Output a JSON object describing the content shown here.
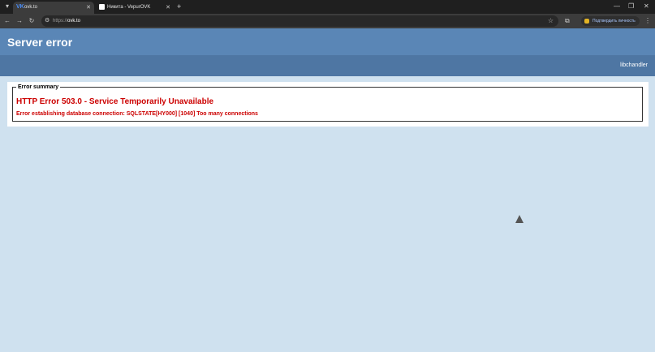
{
  "browser": {
    "tabs": [
      {
        "title": "ovk.to",
        "active": true,
        "icon": "vk-favicon"
      },
      {
        "title": "Никита - VepurOVK",
        "active": false,
        "icon": "page-favicon"
      }
    ],
    "new_tab_label": "+",
    "url_scheme": "https://",
    "url_host": "ovk.to",
    "confirm_label": "Подтвердить личность",
    "icons": {
      "tab_list": "▾",
      "back": "←",
      "forward": "→",
      "reload": "↻",
      "site_info": "⚙",
      "star": "☆",
      "extensions": "⧉",
      "menu": "⋮",
      "minimize": "—",
      "restore": "❐",
      "close": "✕",
      "tab_close": "✕",
      "vk": "VK"
    },
    "colors": {
      "accent_link": "#a9c7ff",
      "badge": "#e2b325"
    }
  },
  "page": {
    "title": "Server error",
    "handler": "libchandler",
    "summary_legend": "Error summary",
    "error_title": "HTTP Error 503.0 - Service Temporarily Unavailable",
    "error_detail": "Error establishing database connection: SQLSTATE[HY000] [1040] Too many connections",
    "colors": {
      "header_bg": "#5a86b6",
      "subheader_bg": "#4e76a3",
      "page_bg": "#cfe1ef",
      "error_text": "#cc0000"
    }
  }
}
